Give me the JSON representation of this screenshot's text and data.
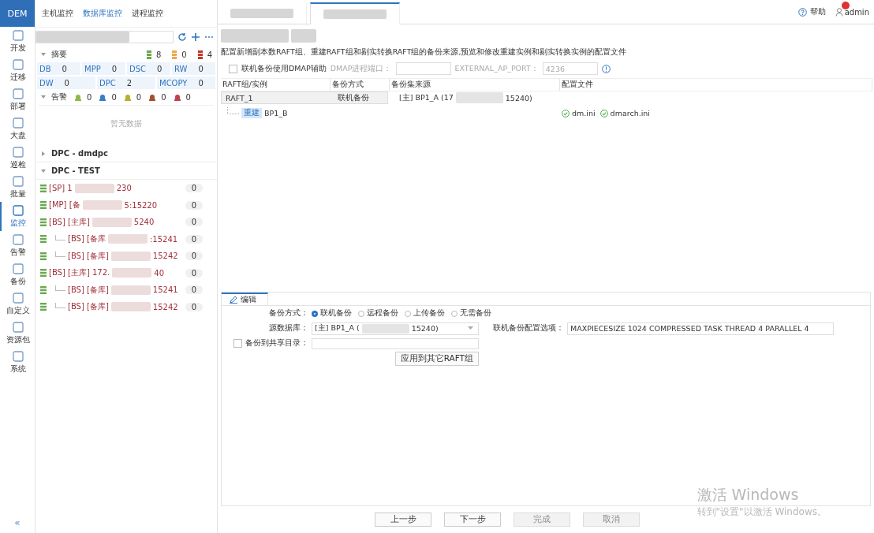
{
  "logo": "DEM",
  "nav": [
    {
      "label": "开发",
      "selected": false
    },
    {
      "label": "迁移",
      "selected": false
    },
    {
      "label": "部署",
      "selected": false
    },
    {
      "label": "大盘",
      "selected": false
    },
    {
      "label": "巡检",
      "selected": false
    },
    {
      "label": "批量",
      "selected": false
    },
    {
      "label": "监控",
      "selected": true
    },
    {
      "label": "告警",
      "selected": false
    },
    {
      "label": "备份",
      "selected": false
    },
    {
      "label": "自定义",
      "selected": false
    },
    {
      "label": "资源包",
      "selected": false
    },
    {
      "label": "系统",
      "selected": false
    }
  ],
  "collapse_glyph": "«",
  "monitor_tabs": [
    {
      "label": "主机监控",
      "selected": false
    },
    {
      "label": "数据库监控",
      "selected": true
    },
    {
      "label": "进程监控",
      "selected": false
    }
  ],
  "summary": {
    "title": "摘要",
    "expanded": true,
    "status_counts": [
      {
        "count": "8",
        "color": "#6aa84f"
      },
      {
        "count": "0",
        "color": "#f0a848"
      },
      {
        "count": "4",
        "color": "#c0392b"
      }
    ],
    "types": [
      {
        "label": "DB",
        "count": "0"
      },
      {
        "label": "MPP",
        "count": "0"
      },
      {
        "label": "DSC",
        "count": "0"
      },
      {
        "label": "RW",
        "count": "0"
      },
      {
        "label": "DW",
        "count": "0"
      },
      {
        "label": "DPC",
        "count": "2"
      },
      {
        "label": "MCOPY",
        "count": "0"
      }
    ]
  },
  "alerts": {
    "title": "告警",
    "expanded": true,
    "counts": [
      {
        "count": "0",
        "color": "#8fb84a"
      },
      {
        "count": "0",
        "color": "#3a7cc9"
      },
      {
        "count": "0",
        "color": "#b8b030"
      },
      {
        "count": "0",
        "color": "#a0522d"
      },
      {
        "count": "0",
        "color": "#c04050"
      }
    ],
    "empty": "暂无数据"
  },
  "groups": [
    {
      "title": "DPC - dmdpc",
      "expanded": false
    },
    {
      "title": "DPC - TEST",
      "expanded": true,
      "instances": [
        {
          "start": "[SP] 1",
          "end": "230",
          "count": "0"
        },
        {
          "start": "[MP] [备",
          "end": "5:15220",
          "count": "0"
        },
        {
          "start": "[BS] [主库]",
          "end": "5240",
          "count": "0",
          "children": [
            {
              "start": "[BS] [备库",
              "end": ":15241",
              "count": "0"
            },
            {
              "start": "[BS] [备库]",
              "end": "15242",
              "count": "0"
            }
          ]
        },
        {
          "start": "[BS] [主库] 172.",
          "end": "40",
          "count": "0",
          "children": [
            {
              "start": "[BS] [备库]",
              "end": "15241",
              "count": "0"
            },
            {
              "start": "[BS] [备库]",
              "end": "15242",
              "count": "0"
            }
          ]
        }
      ]
    }
  ],
  "page_tabs": [
    {
      "selected": false
    },
    {
      "selected": true
    }
  ],
  "help": "帮助",
  "user": "admin",
  "description": "配置新增副本数RAFT组、重建RAFT组和剔实转换RAFT组的备份来源,预览和修改重建实例和剔实转换实例的配置文件",
  "dmap": {
    "label": "联机备份使用DMAP辅助",
    "checked": false,
    "port_label": "DMAP进程端口：",
    "ext_label": "EXTERNAL_AP_PORT：",
    "ext_value": "4236"
  },
  "table": {
    "columns": [
      "RAFT组/实例",
      "备份方式",
      "备份集来源",
      "配置文件"
    ],
    "groups": [
      {
        "name": "RAFT_1",
        "selected": true,
        "method": "联机备份",
        "source_start": "[主] BP1_A (17",
        "source_end": "15240)",
        "children": [
          {
            "tag": "重建",
            "name": "BP1_B",
            "files": [
              "dm.ini",
              "dmarch.ini"
            ]
          }
        ]
      }
    ]
  },
  "edit": {
    "tab": "编辑",
    "method_label": "备份方式：",
    "methods": [
      {
        "label": "联机备份",
        "selected": true
      },
      {
        "label": "远程备份",
        "selected": false
      },
      {
        "label": "上传备份",
        "selected": false
      },
      {
        "label": "无需备份",
        "selected": false
      }
    ],
    "source_label": "源数据库：",
    "source_start": "[主] BP1_A (",
    "source_end": "15240)",
    "options_label": "联机备份配置选项：",
    "options_value": "MAXPIECESIZE 1024 COMPRESSED TASK THREAD 4 PARALLEL 4",
    "share": {
      "label": "备份到共享目录：",
      "checked": false
    },
    "apply": "应用到其它RAFT组"
  },
  "footer": [
    {
      "label": "上一步",
      "disabled": false
    },
    {
      "label": "下一步",
      "disabled": false
    },
    {
      "label": "完成",
      "disabled": true
    },
    {
      "label": "取消",
      "disabled": true
    }
  ],
  "watermark": {
    "title": "激活 Windows",
    "subtitle": "转到\"设置\"以激活 Windows。"
  }
}
